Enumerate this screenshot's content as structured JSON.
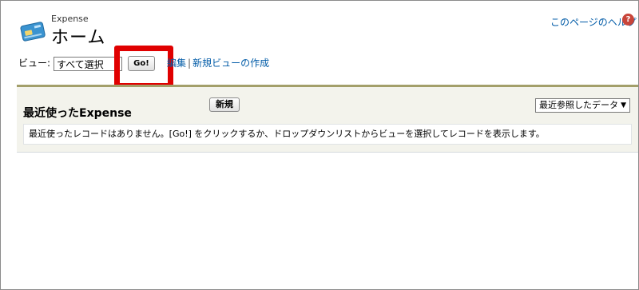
{
  "header": {
    "object_label": "Expense",
    "page_title": "ホーム",
    "help_link": "このページのヘルプ",
    "help_icon_glyph": "?"
  },
  "view_bar": {
    "label": "ビュー:",
    "selected_view": "すべて選択",
    "go_label": "Go!",
    "edit_link": "編集",
    "separator": "|",
    "new_view_link": "新規ビューの作成"
  },
  "recent_panel": {
    "title": "最近使ったExpense",
    "new_button": "新規",
    "recent_select": "最近参照したデータ",
    "recent_select_arrow": "▼",
    "empty_message": "最近使ったレコードはありません。[Go!] をクリックするか、ドロップダウンリストからビューを選択してレコードを表示します。"
  },
  "colors": {
    "link": "#015ba7",
    "highlight_box": "#e00000",
    "panel_accent": "#a39f6a",
    "panel_bg": "#f3f3ec"
  },
  "icons": {
    "app_icon": "credit-card-icon",
    "help_icon": "help-icon"
  }
}
